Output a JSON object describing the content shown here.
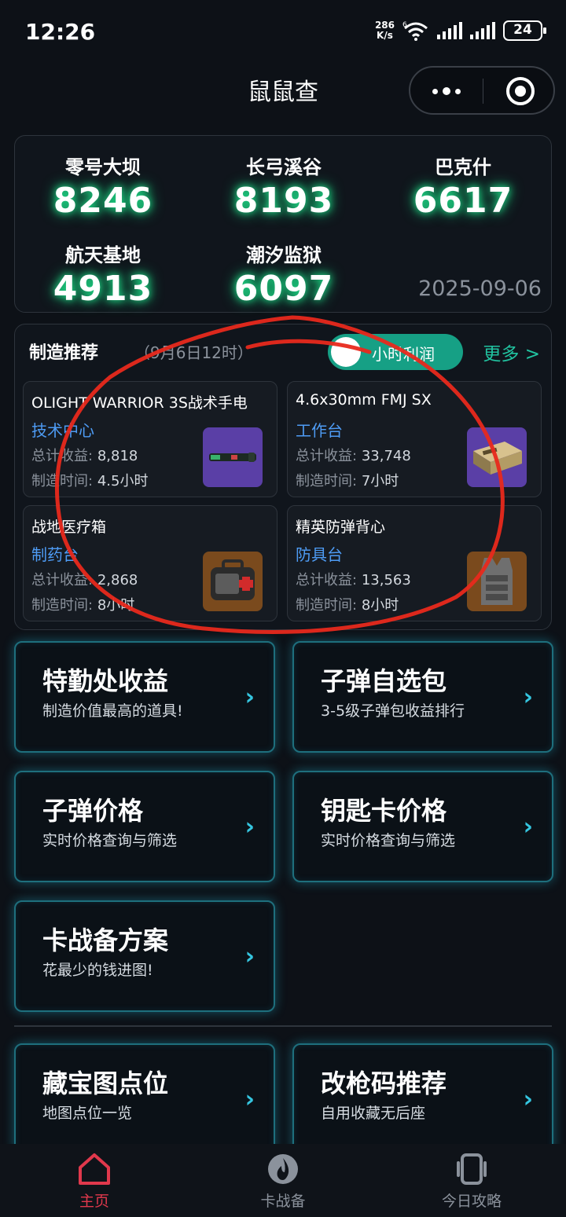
{
  "status_bar": {
    "time": "12:26",
    "net_speed_value": "286",
    "net_speed_unit": "K/s",
    "wifi_label": "6",
    "battery": "24"
  },
  "header": {
    "title": "鼠鼠查"
  },
  "maps": {
    "items": [
      {
        "name": "零号大坝",
        "value": "8246"
      },
      {
        "name": "长弓溪谷",
        "value": "8193"
      },
      {
        "name": "巴克什",
        "value": "6617"
      },
      {
        "name": "航天基地",
        "value": "4913"
      },
      {
        "name": "潮汐监狱",
        "value": "6097"
      }
    ],
    "date": "2025-09-06",
    "accent_color": "#1fe08a"
  },
  "crafting": {
    "title": "制造推荐",
    "subtitle": "（9月6日12时）",
    "toggle_label": "小时利润",
    "more_label": "更多 >",
    "income_label": "总计收益:",
    "time_label": "制造时间:",
    "cards": [
      {
        "name": "OLIGHT WARRIOR 3S战术手电",
        "station": "技术中心",
        "income": "8,818",
        "time": "4.5小时",
        "thumb_color": "#5a3fa6",
        "icon": "flashlight-icon"
      },
      {
        "name": "4.6x30mm FMJ SX",
        "station": "工作台",
        "income": "33,748",
        "time": "7小时",
        "thumb_color": "#5a3fa6",
        "icon": "ammo-box-icon"
      },
      {
        "name": "战地医疗箱",
        "station": "制药台",
        "income": "2,868",
        "time": "8小时",
        "thumb_color": "#7a4a1d",
        "icon": "medkit-icon"
      },
      {
        "name": "精英防弹背心",
        "station": "防具台",
        "income": "13,563",
        "time": "8小时",
        "thumb_color": "#7a4a1d",
        "icon": "vest-icon"
      }
    ]
  },
  "menu": {
    "tiles": [
      {
        "title": "特勤处收益",
        "sub": "制造价值最高的道具!"
      },
      {
        "title": "子弹自选包",
        "sub": "3-5级子弹包收益排行"
      },
      {
        "title": "子弹价格",
        "sub": "实时价格查询与筛选"
      },
      {
        "title": "钥匙卡价格",
        "sub": "实时价格查询与筛选"
      },
      {
        "title": "卡战备方案",
        "sub": "花最少的钱进图!"
      },
      {
        "title": "藏宝图点位",
        "sub": "地图点位一览"
      },
      {
        "title": "改枪码推荐",
        "sub": "自用收藏无后座"
      }
    ],
    "arrow": "›"
  },
  "tabbar": {
    "tabs": [
      {
        "label": "主页",
        "icon": "home-icon",
        "active": true
      },
      {
        "label": "卡战备",
        "icon": "flame-icon",
        "active": false
      },
      {
        "label": "今日攻略",
        "icon": "phone-icon",
        "active": false
      }
    ],
    "active_color": "#e0384c"
  },
  "annotation_color": "#e8291c"
}
